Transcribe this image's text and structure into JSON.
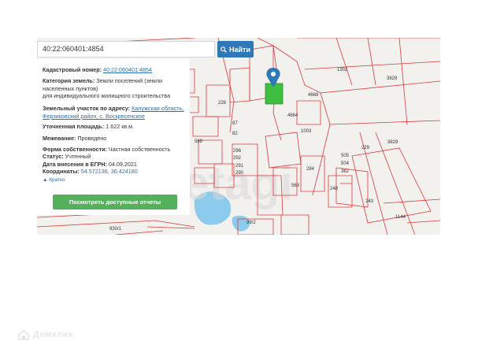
{
  "search": {
    "value": "40:22:060401:4854",
    "button_label": "Найти"
  },
  "info": {
    "cadastral_label": "Кадастровый номер:",
    "cadastral_value": "40:22:060401:4854",
    "category_label": "Категория земель:",
    "category_value_1": "Земли поселений (земли",
    "category_value_2": "населенных пунктов)",
    "category_value_3": "для индивидуального жилищного строительства",
    "address_label": "Земельный участок по адресу:",
    "address_value_1": "Калужская область,",
    "address_value_2": "Ферзиковский район, с. Воскресенское",
    "area_label": "Уточненная площадь:",
    "area_value": "1 622 кв.м.",
    "survey_label": "Межевание:",
    "survey_value": "Проведено",
    "ownership_label": "Форма собственности:",
    "ownership_value": "Частная собственность",
    "status_label": "Статус:",
    "status_value": "Учтенный",
    "egrn_label": "Дата внесения в ЕГРН:",
    "egrn_value": "04.09.2021",
    "coords_label": "Координаты:",
    "coords_value": "54.572136, 36.424180",
    "brief_link": "Кратко",
    "report_button": "Посмотреть доступные отчеты"
  },
  "map": {
    "parcel_labels": [
      "1302",
      "3829",
      "3829",
      "4668",
      "229",
      "4664",
      "505",
      "504",
      "382",
      "248",
      "243",
      "563",
      "296",
      "292",
      "291",
      "290",
      "569",
      "82",
      "87",
      "228",
      "930/1",
      "99/2",
      "1144",
      "1003",
      "284"
    ],
    "watermark_text": "etagi"
  },
  "footer": {
    "brand": "Домклик"
  },
  "colors": {
    "accent_blue": "#2f78b8",
    "report_green": "#55b05b",
    "parcel_red": "#d9383b",
    "water": "#7ec2e6",
    "selected_parcel": "#3fbf3f"
  }
}
